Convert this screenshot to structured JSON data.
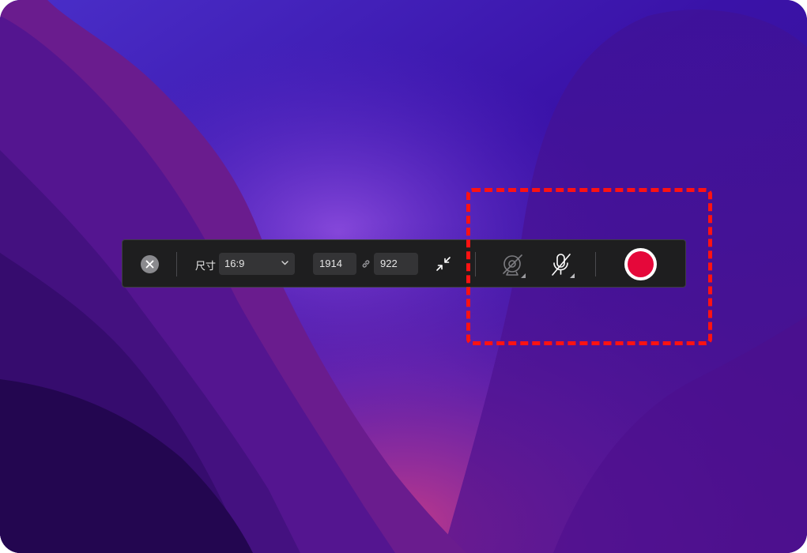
{
  "toolbar": {
    "close_icon": "close-icon",
    "size_label": "尺寸",
    "aspect_ratio": {
      "selected": "16:9",
      "icon": "chevron-down-icon"
    },
    "width_value": "1914",
    "link_icon": "link-icon",
    "height_value": "922",
    "shrink_icon": "arrows-shrink-icon",
    "camera_icon": "camera-off-icon",
    "mic_icon": "microphone-off-icon",
    "record_icon": "record-icon"
  },
  "colors": {
    "toolbar_bg": "#1e1e1f",
    "field_bg": "#343436",
    "record_red": "#e5083a",
    "highlight_red": "#ff1212",
    "wallpaper_purple": "#3b12a0"
  }
}
